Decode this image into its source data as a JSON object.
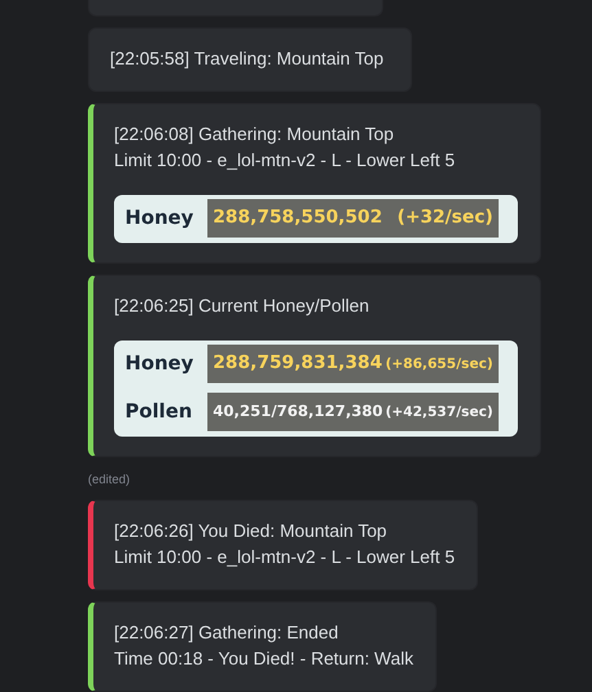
{
  "messages": [
    {
      "lines": [
        "[22:05:58] Traveling: Mountain Top"
      ]
    },
    {
      "color": "#7ed35a",
      "lines": [
        "[22:06:08] Gathering: Mountain Top",
        "Limit 10:00 - e_lol-mtn-v2 - L - Lower Left 5"
      ],
      "stats": [
        {
          "kind": "honey",
          "label": "Honey",
          "value": "288,758,550,502",
          "rate": "(+32/sec)"
        }
      ]
    },
    {
      "color": "#7ed35a",
      "lines": [
        "[22:06:25] Current Honey/Pollen"
      ],
      "stats": [
        {
          "kind": "honey",
          "label": "Honey",
          "value": "288,759,831,384",
          "rate": "(+86,655/sec)"
        },
        {
          "kind": "pollen",
          "label": "Pollen",
          "value": "40,251/768,127,380",
          "rate": "(+42,537/sec)"
        }
      ],
      "edited": "(edited)"
    },
    {
      "color": "#e8364f",
      "lines": [
        "[22:06:26] You Died: Mountain Top",
        "Limit 10:00 - e_lol-mtn-v2 - L - Lower Left 5"
      ]
    },
    {
      "color": "#7ed35a",
      "lines": [
        "[22:06:27] Gathering: Ended",
        "Time 00:18 - You Died! - Return: Walk"
      ]
    }
  ]
}
